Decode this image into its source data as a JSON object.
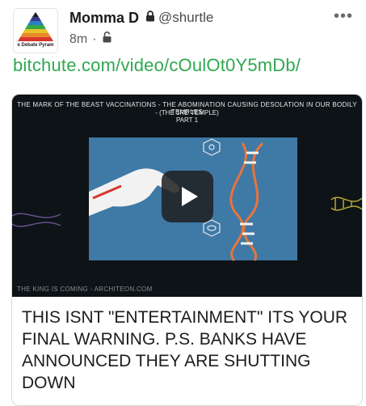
{
  "post": {
    "author_name": "Momma D",
    "handle": "@shurtle",
    "time": "8m",
    "meta_separator": "·",
    "link": "bitchute.com/video/cOulOt0Y5mDb/",
    "more": "•••"
  },
  "avatar": {
    "caption": "e Debate Pyram"
  },
  "card": {
    "video": {
      "title_line1": "THE MARK OF THE BEAST VACCINATIONS - THE ABOMINATION CAUSING DESOLATION IN OUR BODILY TEMPLES",
      "title_line2": "- (THE 3RD TEMPLE)",
      "title_line3": "PART 1",
      "footer": "THE KING IS COMING - ARCHITEON.COM"
    },
    "title": "THIS ISNT \"ENTERTAINMENT\" ITS YOUR FINAL WARNING. P.S. BANKS HAVE ANNOUNCED THEY ARE SHUTTING DOWN"
  },
  "colors": {
    "link": "#2fa84f",
    "video_scene": "#3f79a6",
    "dna_orange": "#e8743b"
  }
}
